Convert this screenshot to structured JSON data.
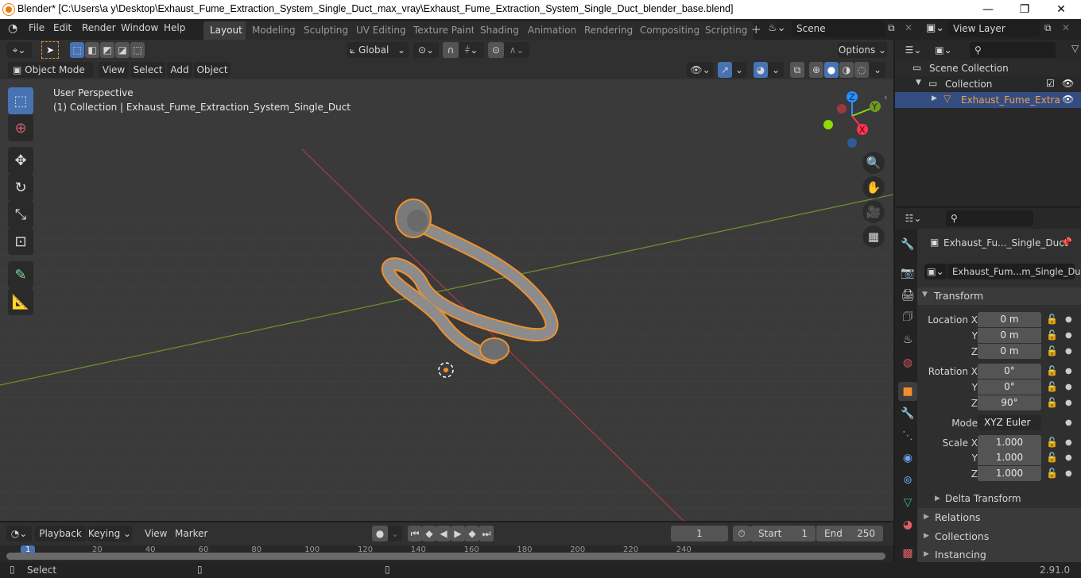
{
  "window": {
    "title": "Blender* [C:\\Users\\a y\\Desktop\\Exhaust_Fume_Extraction_System_Single_Duct_max_vray\\Exhaust_Fume_Extraction_System_Single_Duct_blender_base.blend]",
    "minimize": "—",
    "maximize": "❐",
    "close": "✕"
  },
  "menu": {
    "items": [
      "File",
      "Edit",
      "Render",
      "Window",
      "Help"
    ]
  },
  "workspaces": {
    "tabs": [
      "Layout",
      "Modeling",
      "Sculpting",
      "UV Editing",
      "Texture Paint",
      "Shading",
      "Animation",
      "Rendering",
      "Compositing",
      "Scripting"
    ],
    "active": "Layout",
    "add": "+"
  },
  "scene": {
    "value": "Scene"
  },
  "view_layer": {
    "value": "View Layer"
  },
  "tool_header": {
    "orientation": "Global",
    "options": "Options"
  },
  "view_header": {
    "mode": "Object Mode",
    "menus": [
      "View",
      "Select",
      "Add",
      "Object"
    ]
  },
  "viewport": {
    "perspective": "User Perspective",
    "collection_info": "(1) Collection | Exhaust_Fume_Extraction_System_Single_Duct",
    "gizmo": {
      "x": "X",
      "y": "Y",
      "z": "Z"
    },
    "axis_colors": {
      "x": "#ff3352",
      "y": "#8bdc00",
      "z": "#2890ff"
    },
    "selection_color": "#f0902c"
  },
  "outliner": {
    "scene_collection": "Scene Collection",
    "collection": "Collection",
    "object": "Exhaust_Fume_Extra"
  },
  "properties": {
    "object_name": "Exhaust_Fu..._Single_Duct",
    "datablock": "Exhaust_Fum...m_Single_Duct",
    "transform_label": "Transform",
    "location": {
      "label": "Location X",
      "x": "0 m",
      "y": "0 m",
      "z": "0 m"
    },
    "rotation": {
      "label": "Rotation X",
      "x": "0°",
      "y": "0°",
      "z": "90°"
    },
    "mode_label": "Mode",
    "mode_value": "XYZ Euler",
    "scale": {
      "label": "Scale X",
      "x": "1.000",
      "y": "1.000",
      "z": "1.000"
    },
    "axis_y": "Y",
    "axis_z": "Z",
    "delta": "Delta Transform",
    "sections": [
      "Relations",
      "Collections",
      "Instancing"
    ]
  },
  "timeline": {
    "menus": [
      "Playback",
      "Keying",
      "View",
      "Marker"
    ],
    "current_frame": "1",
    "start_label": "Start",
    "start": "1",
    "end_label": "End",
    "end": "250",
    "ticks": [
      "1",
      "20",
      "40",
      "60",
      "80",
      "100",
      "120",
      "140",
      "160",
      "180",
      "200",
      "220",
      "240"
    ]
  },
  "statusbar": {
    "left": "Select",
    "version": "2.91.0"
  }
}
